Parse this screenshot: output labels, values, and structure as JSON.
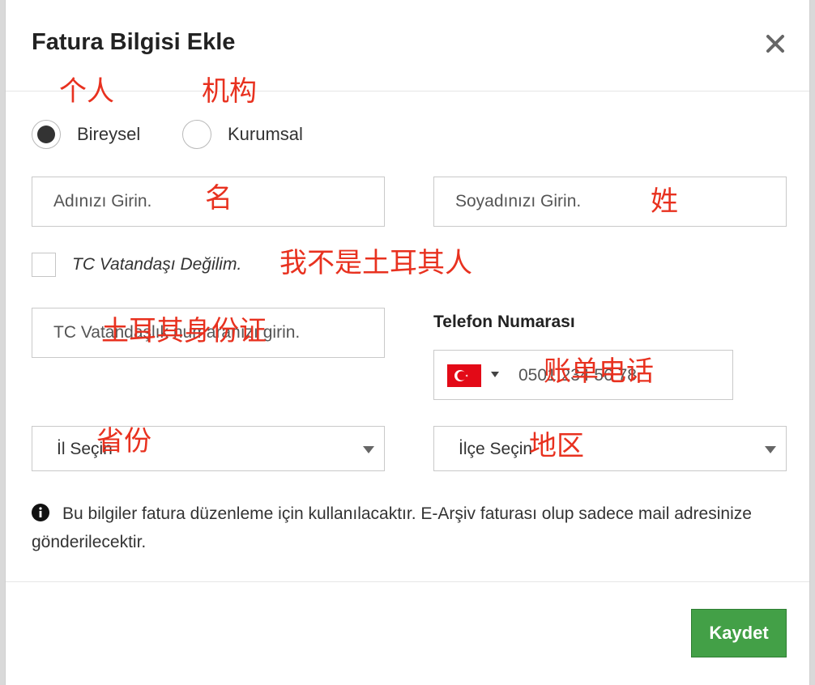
{
  "dialog": {
    "title": "Fatura Bilgisi Ekle",
    "close_icon": "close-icon"
  },
  "account_type": {
    "options": [
      {
        "label": "Bireysel",
        "selected": true
      },
      {
        "label": "Kurumsal",
        "selected": false
      }
    ]
  },
  "form": {
    "first_name_placeholder": "Adınızı Girin.",
    "last_name_placeholder": "Soyadınızı Girin.",
    "not_tc_citizen_label": "TC Vatandaşı Değilim.",
    "tc_id_placeholder": "TC Vatandaşlık numaranızı girin.",
    "phone_label": "Telefon Numarası",
    "phone_value": "0501 234 56 78",
    "phone_country_flag": "turkey-flag-icon",
    "province_select": "İl Seçin",
    "district_select": "İlçe Seçin"
  },
  "info": {
    "icon": "info-icon",
    "text": "Bu bilgiler fatura düzenleme için kullanılacaktır. E-Arşiv faturası olup sadece mail adresinize gönderilecektir."
  },
  "actions": {
    "save_label": "Kaydet"
  },
  "annotations": {
    "individual": "个人",
    "institution": "机构",
    "first_name": "名",
    "last_name": "姓",
    "not_turkish": "我不是土耳其人",
    "turkish_id": "土耳其身份证",
    "billing_phone": "账单电话",
    "province": "省份",
    "district": "地区"
  },
  "colors": {
    "accent_green": "#43a047",
    "annotation_red": "#e8311f",
    "flag_red": "#e30a17"
  }
}
